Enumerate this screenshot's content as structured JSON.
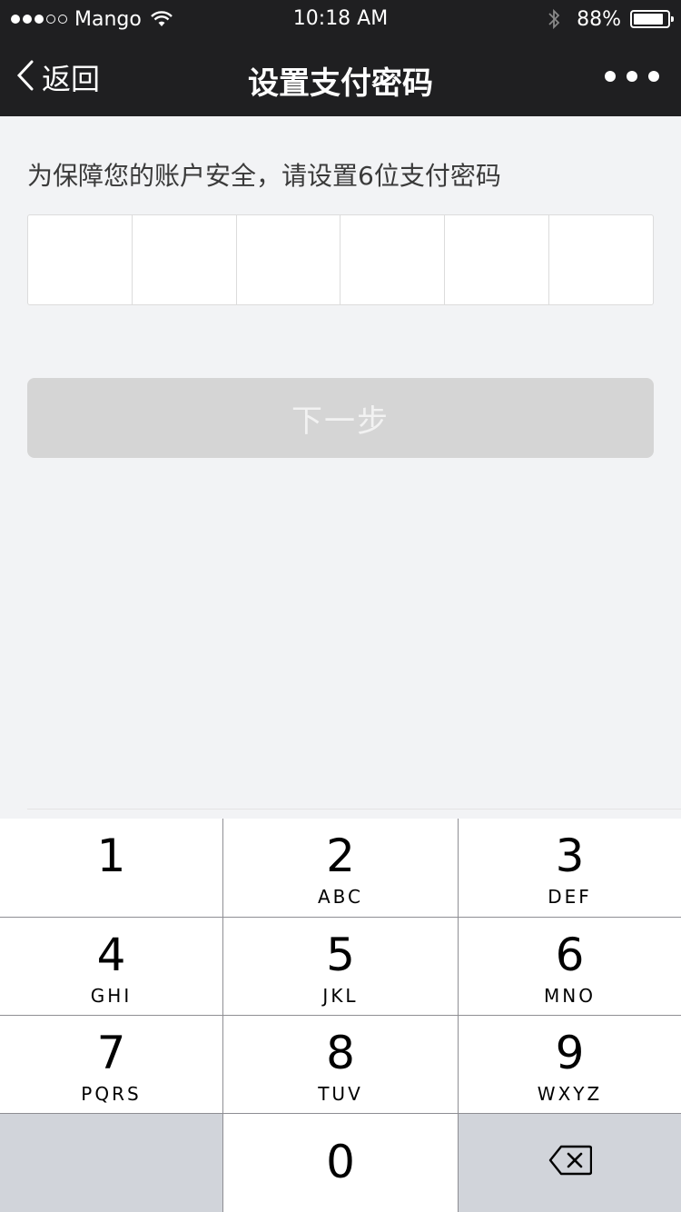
{
  "status_bar": {
    "carrier": "Mango",
    "time": "10:18 AM",
    "battery": "88%",
    "battery_level": 0.88,
    "signal_bars_filled": 3,
    "signal_bars_total": 5
  },
  "nav": {
    "back_label": "返回",
    "title": "设置支付密码"
  },
  "content": {
    "hint": "为保障您的账户安全，请设置6位支付密码",
    "password_cells": 6,
    "next_button": "下一步"
  },
  "keypad": {
    "keys": [
      {
        "num": "1",
        "letters": ""
      },
      {
        "num": "2",
        "letters": "ABC"
      },
      {
        "num": "3",
        "letters": "DEF"
      },
      {
        "num": "4",
        "letters": "GHI"
      },
      {
        "num": "5",
        "letters": "JKL"
      },
      {
        "num": "6",
        "letters": "MNO"
      },
      {
        "num": "7",
        "letters": "PQRS"
      },
      {
        "num": "8",
        "letters": "TUV"
      },
      {
        "num": "9",
        "letters": "WXYZ"
      },
      {
        "num": "0",
        "letters": ""
      }
    ]
  },
  "colors": {
    "nav_bg": "#1f1f21",
    "page_bg": "#f2f3f5",
    "button_disabled": "#d5d5d5",
    "keypad_gray": "#d1d4da"
  }
}
